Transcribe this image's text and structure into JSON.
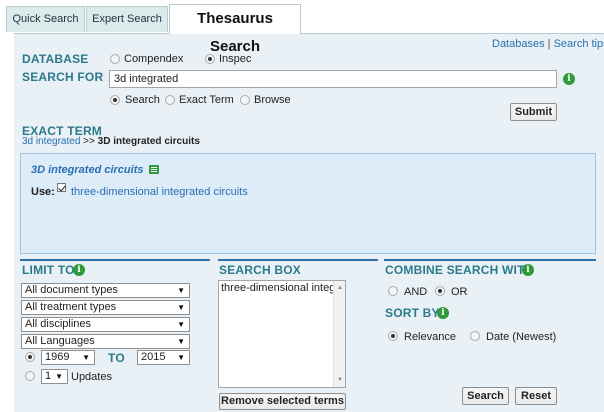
{
  "tabs": [
    {
      "label": "Quick Search"
    },
    {
      "label": "Expert Search"
    },
    {
      "label": "Thesaurus Search"
    }
  ],
  "top_links": {
    "databases": "Databases",
    "separator": "|",
    "search_tips": "Search tips"
  },
  "database": {
    "label": "DATABASE",
    "options": [
      {
        "label": "Compendex",
        "selected": false
      },
      {
        "label": "Inspec",
        "selected": true
      }
    ]
  },
  "search_for": {
    "label": "SEARCH FOR",
    "value": "3d integrated",
    "modes": [
      {
        "label": "Search",
        "selected": true
      },
      {
        "label": "Exact Term",
        "selected": false
      },
      {
        "label": "Browse",
        "selected": false
      }
    ],
    "submit_label": "Submit"
  },
  "exact_term": {
    "label": "EXACT TERM",
    "breadcrumb_link": "3d integrated",
    "breadcrumb_sep": ">>",
    "breadcrumb_current": "3D integrated circuits",
    "term_title": "3D integrated circuits",
    "use_label": "Use:",
    "use_term": "three-dimensional integrated circuits",
    "use_checked": true
  },
  "limit_to": {
    "label": "LIMIT TO",
    "document_types": "All document types",
    "treatment_types": "All treatment types",
    "disciplines": "All disciplines",
    "languages": "All Languages",
    "year_from": "1969",
    "to_label": "TO",
    "year_to": "2015",
    "range_selected": true,
    "updates_count": "1",
    "updates_label": "Updates",
    "updates_selected": false
  },
  "search_box": {
    "label": "SEARCH BOX",
    "content": "three-dimensional integrated circuits",
    "remove_label": "Remove selected terms"
  },
  "combine": {
    "label": "COMBINE SEARCH WITH",
    "options": [
      {
        "label": "AND",
        "selected": false
      },
      {
        "label": "OR",
        "selected": true
      }
    ]
  },
  "sort_by": {
    "label": "SORT BY",
    "options": [
      {
        "label": "Relevance",
        "selected": true
      },
      {
        "label": "Date (Newest)",
        "selected": false
      }
    ]
  },
  "actions": {
    "search_label": "Search",
    "reset_label": "Reset"
  },
  "colors": {
    "accent": "#2b7a8c",
    "link": "#2a6fb0",
    "info": "#2e9a3a",
    "panel": "#e9f1f6",
    "term_box": "#dcecf9"
  }
}
